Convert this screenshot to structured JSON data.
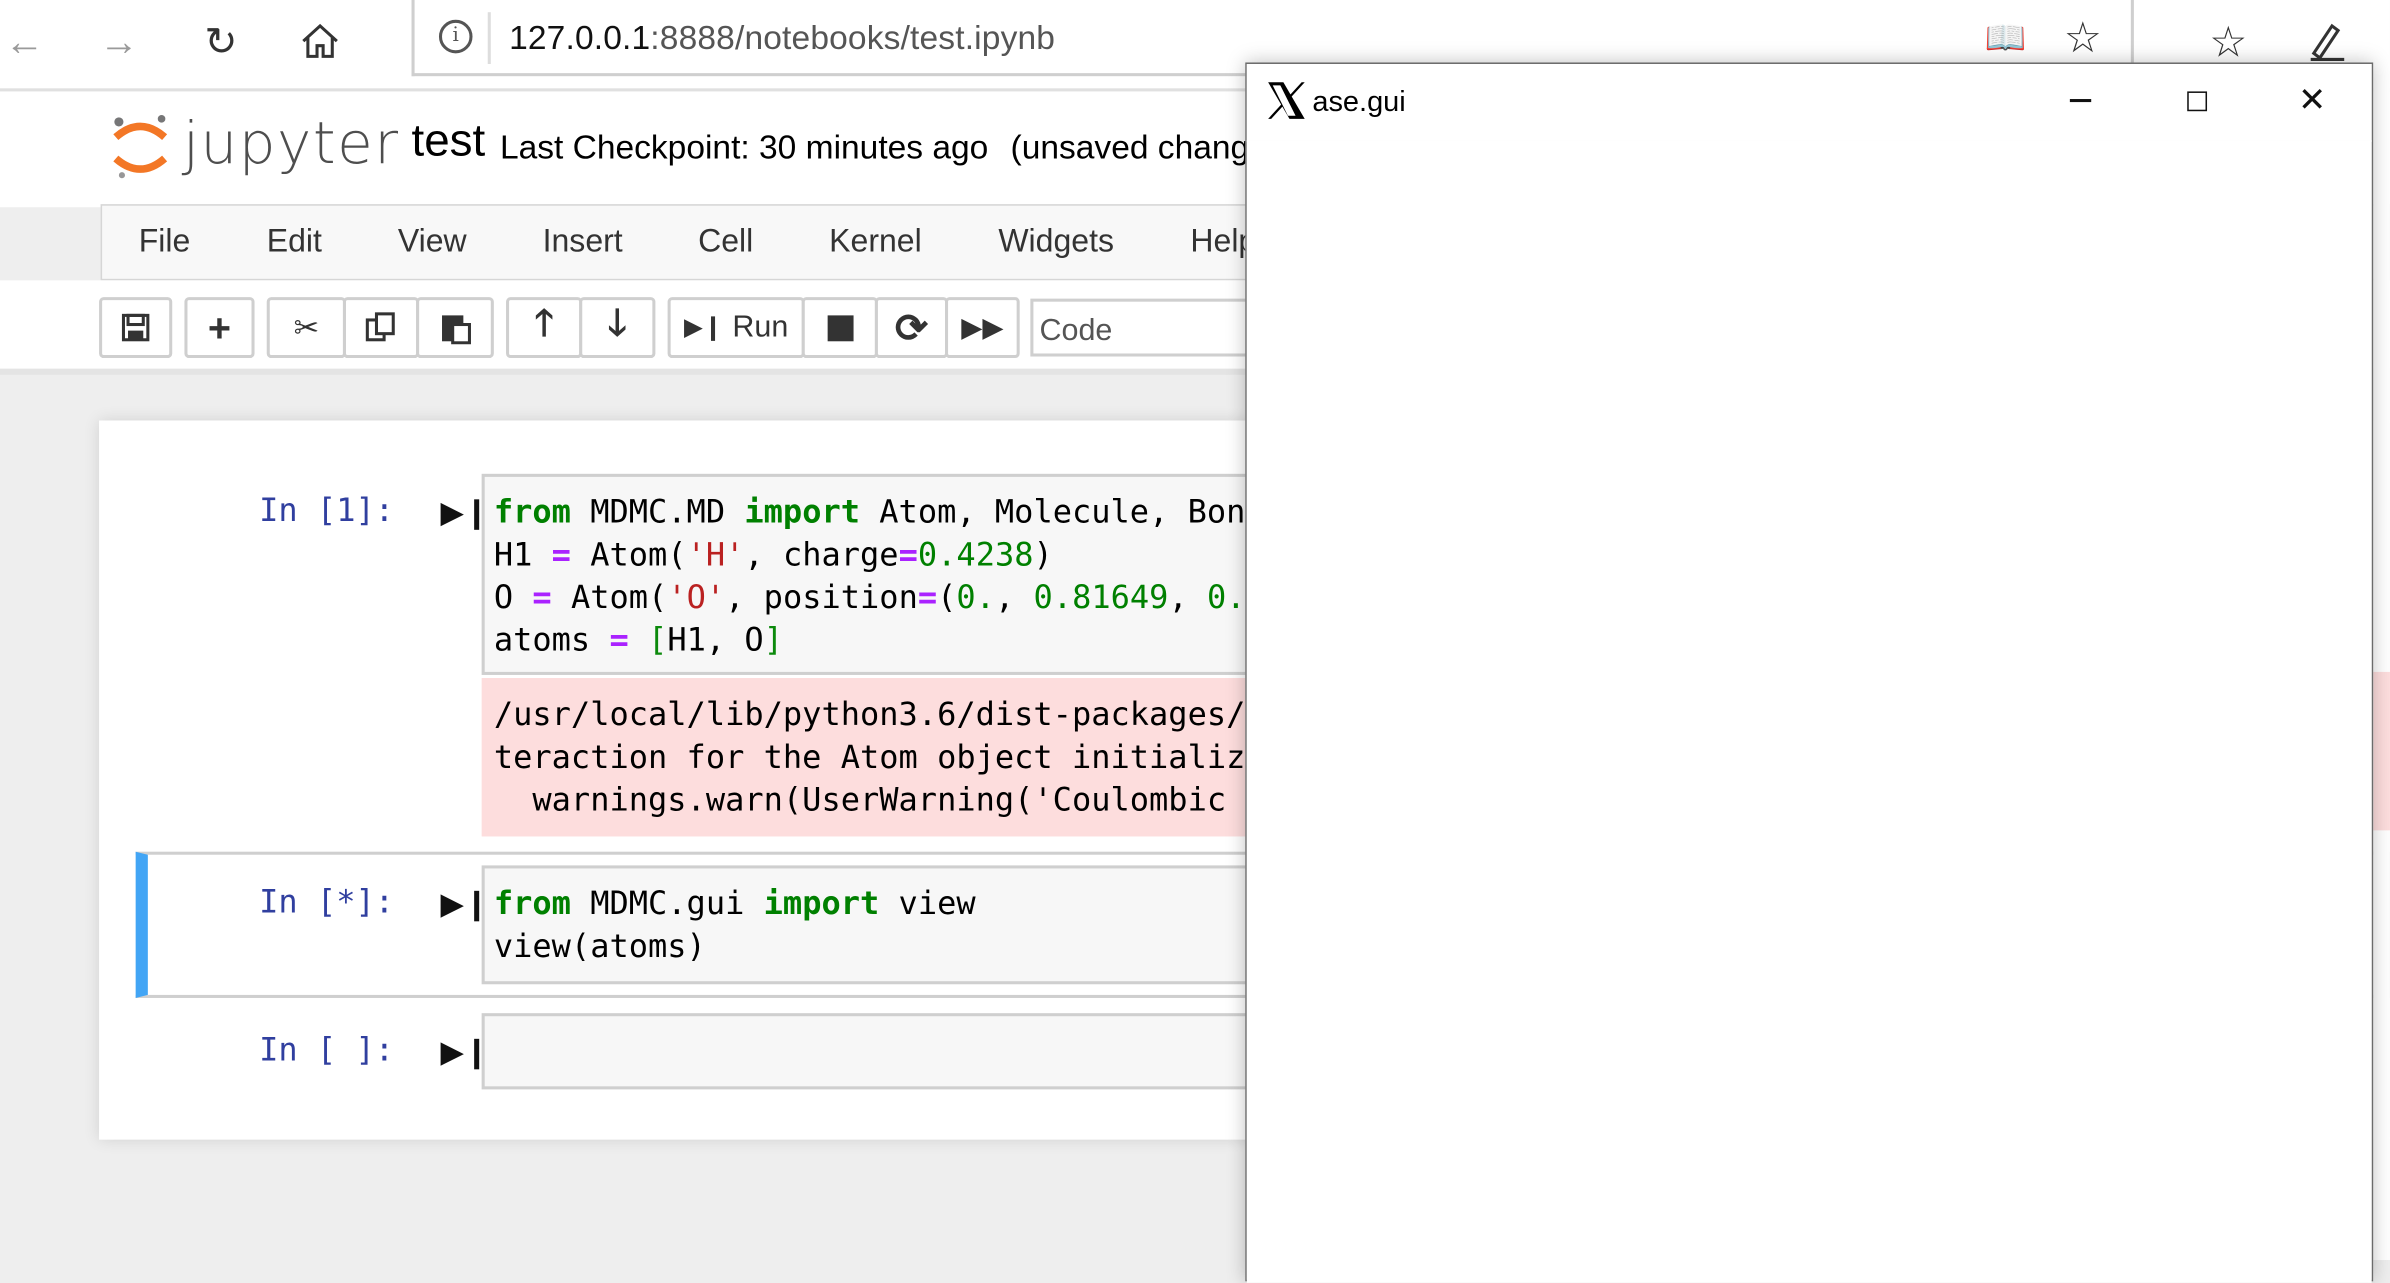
{
  "browser": {
    "url_host": "127.0.0.1",
    "url_rest": ":8888/notebooks/test.ipynb"
  },
  "jupyter": {
    "logo_text": "jupyter",
    "notebook_name": "test",
    "checkpoint": "Last Checkpoint: 30 minutes ago",
    "unsaved": "(unsaved chang"
  },
  "menu": {
    "items": [
      "File",
      "Edit",
      "View",
      "Insert",
      "Cell",
      "Kernel",
      "Widgets",
      "Help"
    ]
  },
  "toolbar": {
    "run_label": "Run",
    "cell_type": "Code"
  },
  "cells": {
    "c1": {
      "prompt": "In [1]:",
      "stderr": [
        "/usr/local/lib/python3.6/dist-packages/",
        "teraction for the Atom object initializ",
        "  warnings.warn(UserWarning('Coulombic "
      ]
    },
    "c2": {
      "prompt": "In [*]:"
    },
    "c3": {
      "prompt": "In [ ]:"
    }
  },
  "ase_window": {
    "title": "ase.gui"
  },
  "colors": {
    "prompt": "#303f9f",
    "keyword": "#008000",
    "string": "#ba2121",
    "stderr_bg": "#fddddd",
    "selected_cell": "#42a5f5"
  }
}
